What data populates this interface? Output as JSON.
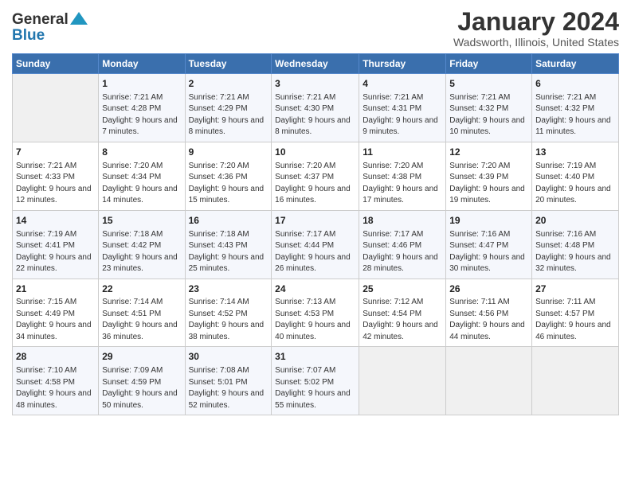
{
  "header": {
    "logo_general": "General",
    "logo_blue": "Blue",
    "month_title": "January 2024",
    "location": "Wadsworth, Illinois, United States"
  },
  "days_of_week": [
    "Sunday",
    "Monday",
    "Tuesday",
    "Wednesday",
    "Thursday",
    "Friday",
    "Saturday"
  ],
  "weeks": [
    [
      {
        "day": "",
        "sunrise": "",
        "sunset": "",
        "daylight": ""
      },
      {
        "day": "1",
        "sunrise": "Sunrise: 7:21 AM",
        "sunset": "Sunset: 4:28 PM",
        "daylight": "Daylight: 9 hours and 7 minutes."
      },
      {
        "day": "2",
        "sunrise": "Sunrise: 7:21 AM",
        "sunset": "Sunset: 4:29 PM",
        "daylight": "Daylight: 9 hours and 8 minutes."
      },
      {
        "day": "3",
        "sunrise": "Sunrise: 7:21 AM",
        "sunset": "Sunset: 4:30 PM",
        "daylight": "Daylight: 9 hours and 8 minutes."
      },
      {
        "day": "4",
        "sunrise": "Sunrise: 7:21 AM",
        "sunset": "Sunset: 4:31 PM",
        "daylight": "Daylight: 9 hours and 9 minutes."
      },
      {
        "day": "5",
        "sunrise": "Sunrise: 7:21 AM",
        "sunset": "Sunset: 4:32 PM",
        "daylight": "Daylight: 9 hours and 10 minutes."
      },
      {
        "day": "6",
        "sunrise": "Sunrise: 7:21 AM",
        "sunset": "Sunset: 4:32 PM",
        "daylight": "Daylight: 9 hours and 11 minutes."
      }
    ],
    [
      {
        "day": "7",
        "sunrise": "Sunrise: 7:21 AM",
        "sunset": "Sunset: 4:33 PM",
        "daylight": "Daylight: 9 hours and 12 minutes."
      },
      {
        "day": "8",
        "sunrise": "Sunrise: 7:20 AM",
        "sunset": "Sunset: 4:34 PM",
        "daylight": "Daylight: 9 hours and 14 minutes."
      },
      {
        "day": "9",
        "sunrise": "Sunrise: 7:20 AM",
        "sunset": "Sunset: 4:36 PM",
        "daylight": "Daylight: 9 hours and 15 minutes."
      },
      {
        "day": "10",
        "sunrise": "Sunrise: 7:20 AM",
        "sunset": "Sunset: 4:37 PM",
        "daylight": "Daylight: 9 hours and 16 minutes."
      },
      {
        "day": "11",
        "sunrise": "Sunrise: 7:20 AM",
        "sunset": "Sunset: 4:38 PM",
        "daylight": "Daylight: 9 hours and 17 minutes."
      },
      {
        "day": "12",
        "sunrise": "Sunrise: 7:20 AM",
        "sunset": "Sunset: 4:39 PM",
        "daylight": "Daylight: 9 hours and 19 minutes."
      },
      {
        "day": "13",
        "sunrise": "Sunrise: 7:19 AM",
        "sunset": "Sunset: 4:40 PM",
        "daylight": "Daylight: 9 hours and 20 minutes."
      }
    ],
    [
      {
        "day": "14",
        "sunrise": "Sunrise: 7:19 AM",
        "sunset": "Sunset: 4:41 PM",
        "daylight": "Daylight: 9 hours and 22 minutes."
      },
      {
        "day": "15",
        "sunrise": "Sunrise: 7:18 AM",
        "sunset": "Sunset: 4:42 PM",
        "daylight": "Daylight: 9 hours and 23 minutes."
      },
      {
        "day": "16",
        "sunrise": "Sunrise: 7:18 AM",
        "sunset": "Sunset: 4:43 PM",
        "daylight": "Daylight: 9 hours and 25 minutes."
      },
      {
        "day": "17",
        "sunrise": "Sunrise: 7:17 AM",
        "sunset": "Sunset: 4:44 PM",
        "daylight": "Daylight: 9 hours and 26 minutes."
      },
      {
        "day": "18",
        "sunrise": "Sunrise: 7:17 AM",
        "sunset": "Sunset: 4:46 PM",
        "daylight": "Daylight: 9 hours and 28 minutes."
      },
      {
        "day": "19",
        "sunrise": "Sunrise: 7:16 AM",
        "sunset": "Sunset: 4:47 PM",
        "daylight": "Daylight: 9 hours and 30 minutes."
      },
      {
        "day": "20",
        "sunrise": "Sunrise: 7:16 AM",
        "sunset": "Sunset: 4:48 PM",
        "daylight": "Daylight: 9 hours and 32 minutes."
      }
    ],
    [
      {
        "day": "21",
        "sunrise": "Sunrise: 7:15 AM",
        "sunset": "Sunset: 4:49 PM",
        "daylight": "Daylight: 9 hours and 34 minutes."
      },
      {
        "day": "22",
        "sunrise": "Sunrise: 7:14 AM",
        "sunset": "Sunset: 4:51 PM",
        "daylight": "Daylight: 9 hours and 36 minutes."
      },
      {
        "day": "23",
        "sunrise": "Sunrise: 7:14 AM",
        "sunset": "Sunset: 4:52 PM",
        "daylight": "Daylight: 9 hours and 38 minutes."
      },
      {
        "day": "24",
        "sunrise": "Sunrise: 7:13 AM",
        "sunset": "Sunset: 4:53 PM",
        "daylight": "Daylight: 9 hours and 40 minutes."
      },
      {
        "day": "25",
        "sunrise": "Sunrise: 7:12 AM",
        "sunset": "Sunset: 4:54 PM",
        "daylight": "Daylight: 9 hours and 42 minutes."
      },
      {
        "day": "26",
        "sunrise": "Sunrise: 7:11 AM",
        "sunset": "Sunset: 4:56 PM",
        "daylight": "Daylight: 9 hours and 44 minutes."
      },
      {
        "day": "27",
        "sunrise": "Sunrise: 7:11 AM",
        "sunset": "Sunset: 4:57 PM",
        "daylight": "Daylight: 9 hours and 46 minutes."
      }
    ],
    [
      {
        "day": "28",
        "sunrise": "Sunrise: 7:10 AM",
        "sunset": "Sunset: 4:58 PM",
        "daylight": "Daylight: 9 hours and 48 minutes."
      },
      {
        "day": "29",
        "sunrise": "Sunrise: 7:09 AM",
        "sunset": "Sunset: 4:59 PM",
        "daylight": "Daylight: 9 hours and 50 minutes."
      },
      {
        "day": "30",
        "sunrise": "Sunrise: 7:08 AM",
        "sunset": "Sunset: 5:01 PM",
        "daylight": "Daylight: 9 hours and 52 minutes."
      },
      {
        "day": "31",
        "sunrise": "Sunrise: 7:07 AM",
        "sunset": "Sunset: 5:02 PM",
        "daylight": "Daylight: 9 hours and 55 minutes."
      },
      {
        "day": "",
        "sunrise": "",
        "sunset": "",
        "daylight": ""
      },
      {
        "day": "",
        "sunrise": "",
        "sunset": "",
        "daylight": ""
      },
      {
        "day": "",
        "sunrise": "",
        "sunset": "",
        "daylight": ""
      }
    ]
  ]
}
